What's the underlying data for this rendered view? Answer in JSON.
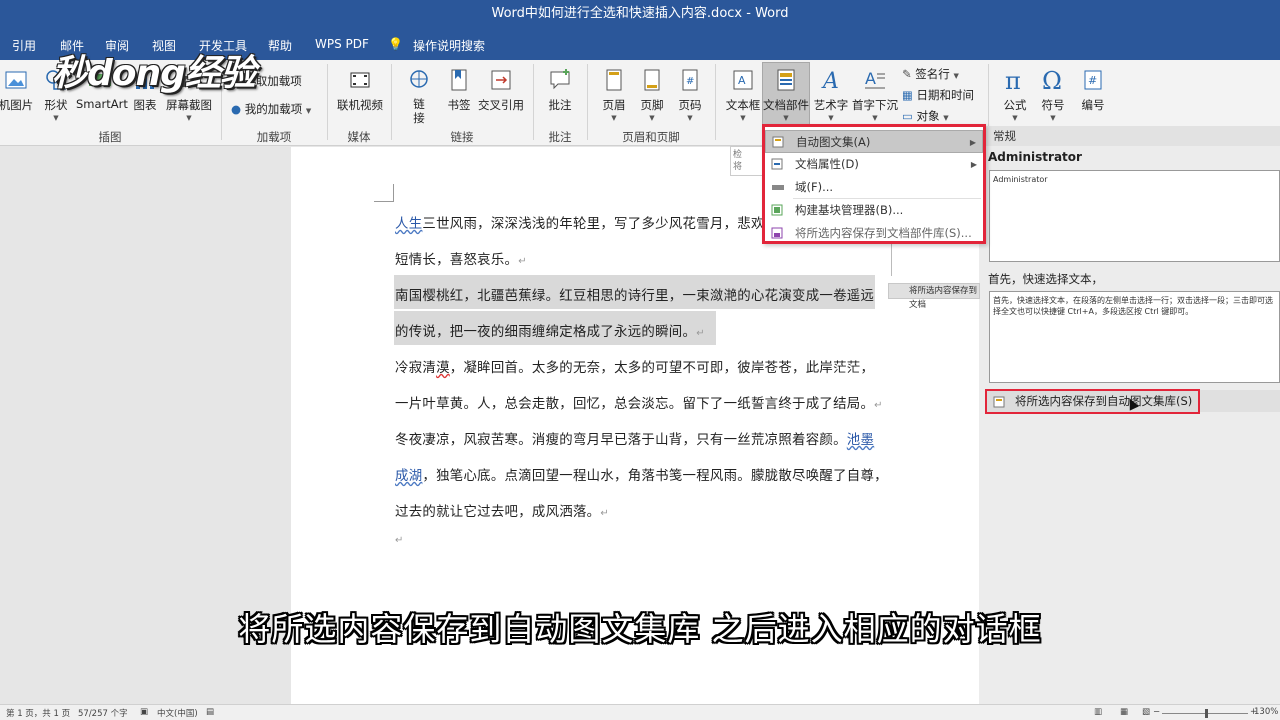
{
  "window": {
    "title": "Word中如何进行全选和快速插入内容.docx  -  Word"
  },
  "tabs": {
    "items": [
      "引用",
      "邮件",
      "审阅",
      "视图",
      "开发工具",
      "帮助",
      "WPS PDF"
    ],
    "tell_me": "操作说明搜索"
  },
  "watermark": {
    "logo_text": "秒dong经验"
  },
  "ribbon": {
    "illustrations": {
      "picture_label": "机图片",
      "shapes_label": "形状",
      "smartart_label": "SmartArt",
      "chart_label": "图表",
      "screenshot_label": "屏幕截图",
      "group_label": "插图"
    },
    "addins": {
      "get_addins": "获取加载项",
      "my_addins": "我的加载项",
      "group_label": "加载项"
    },
    "media": {
      "online_video": "联机视频",
      "group_label": "媒体"
    },
    "links": {
      "link": "链\n接",
      "bookmark": "书签",
      "cross_ref": "交叉引用",
      "group_label": "链接"
    },
    "comments": {
      "comment": "批注",
      "group_label": "批注"
    },
    "header_footer": {
      "header": "页眉",
      "footer": "页脚",
      "page_number": "页码",
      "group_label": "页眉和页脚"
    },
    "text": {
      "textbox": "文本框",
      "quick_parts": "文档部件",
      "wordart": "艺术字",
      "dropcap": "首字下沉",
      "signature": "签名行",
      "datetime": "日期和时间",
      "object": "对象"
    },
    "symbols": {
      "equation": "公式",
      "symbol": "符号",
      "number": "编号"
    }
  },
  "quick_parts_menu": {
    "items": [
      {
        "label": "自动图文集(A)",
        "has_arrow": true
      },
      {
        "label": "文档属性(D)",
        "has_arrow": true
      },
      {
        "label": "域(F)..."
      },
      {
        "label": "构建基块管理器(B)..."
      },
      {
        "label": "将所选内容保存到文档部件库(S)..."
      }
    ]
  },
  "mini_popup": {
    "text_1": "检",
    "text_2": "将"
  },
  "autotext_panel": {
    "header": "常规",
    "entries": [
      {
        "title": "Administrator",
        "preview": "Administrator"
      },
      {
        "title": "首先，快速选择文本，",
        "preview": "首先，快速选择文本，在段落的左侧单击选择一行；双击选择一段；三击即可选择全文也可以快捷键 Ctrl+A，多段选区按 Ctrl 键即可。"
      }
    ],
    "save_button": "将所选内容保存到自动图文集库(S)",
    "ghost_button": "将所选内容保存到文档"
  },
  "document": {
    "lines": [
      {
        "pre_underlined": "人生",
        "text": "三世风雨，深深浅浅的年轮里，写了多少风花雪月，悲欢"
      },
      {
        "text": "短情长，喜怒哀乐。"
      },
      {
        "text": "南国樱桃红，北疆芭蕉绿。红豆相思的诗行里，一束潋滟的心花演变成一卷遥远"
      },
      {
        "text": "的传说，把一夜的细雨缠绵定格成了永远的瞬间。"
      },
      {
        "text_a": "冷寂清",
        "text_red": "漠",
        "text_b": "，凝眸回首。太多的无奈，太多的可望不可即，彼岸苍苍，此岸茫茫，"
      },
      {
        "text": "一片叶草黄。人，总会走散，回忆，总会淡忘。留下了一纸誓言终于成了结局。"
      },
      {
        "text": "冬夜凄凉，风寂苦寒。消瘦的弯月早已落于山背，只有一丝荒凉照着容颜。",
        "underlined_tail": "池墨"
      },
      {
        "underlined_head": "成湖",
        "text": "，独笔心底。点滴回望一程山水，角落书笺一程风雨。朦胧散尽唤醒了自尊，"
      },
      {
        "text": "过去的就让它过去吧，成风洒落。"
      }
    ],
    "para_mark": "↵"
  },
  "subtitle": "将所选内容保存到自动图文集库  之后进入相应的对话框",
  "status": {
    "page": "第 1 页，共 1 页",
    "words": "57/257 个字",
    "language": "中文(中国)",
    "zoom": "130%"
  },
  "colors": {
    "title_bar": "#2b579a",
    "highlight_box": "#e2253a"
  }
}
